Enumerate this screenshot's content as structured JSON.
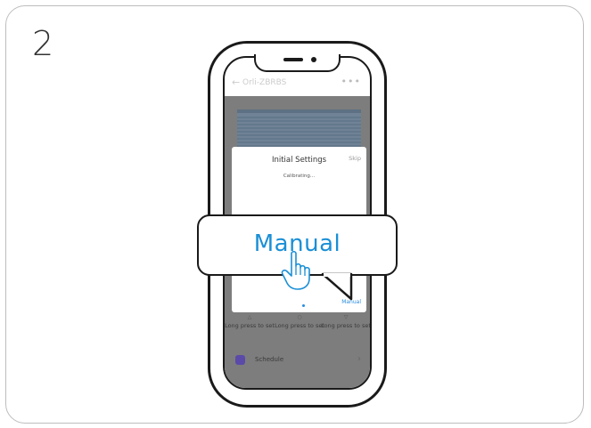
{
  "step": {
    "number": "2"
  },
  "app": {
    "device_name": "Orli-ZBRBS",
    "more_icon": "more-dots-icon",
    "back_icon": "back-arrow-icon"
  },
  "dialog": {
    "title": "Initial Settings",
    "skip": "Skip",
    "status": "Calibrating...",
    "action": "Manual"
  },
  "controls": [
    {
      "label": "Long press to set",
      "icon": "up-icon"
    },
    {
      "label": "Long press to set",
      "icon": "pause-icon"
    },
    {
      "label": "Long press to set",
      "icon": "down-icon"
    }
  ],
  "schedule": {
    "label": "Schedule",
    "icon": "calendar-icon"
  },
  "callout": {
    "label": "Manual",
    "color": "#1a8fd6"
  }
}
